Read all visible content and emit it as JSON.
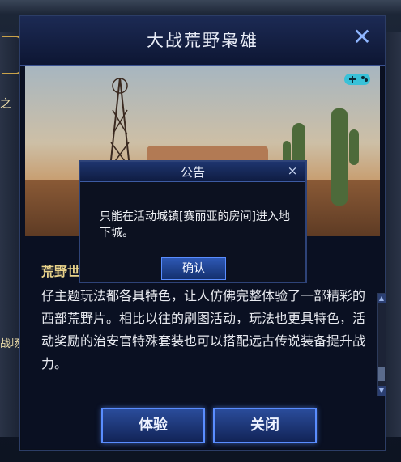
{
  "modal": {
    "title": "大战荒野枭雄",
    "close_glyph": "✕",
    "headline": "荒野世界热血着……德勇士化身西部牛仔",
    "body": "仔主题玩法都各具特色，让人仿佛完整体验了一部精彩的西部荒野片。相比以往的刷图活动，玩法也更具特色，活动奖励的治安官特殊套装也可以搭配远古传说装备提升战力。",
    "buttons": {
      "experience_label": "体验",
      "close_label": "关闭"
    }
  },
  "notice": {
    "title": "公告",
    "close_glyph": "×",
    "message": "只能在活动城镇[赛丽亚的房间]进入地下城。",
    "ok_label": "确认"
  },
  "background": {
    "left_text_1": "之",
    "left_text_2": "战场"
  },
  "colors": {
    "accent": "#5a8dff",
    "headline": "#e9d38b",
    "panel": "#0a1022"
  },
  "icons": {
    "close": "close-icon",
    "gamepad": "gamepad-icon",
    "scroll_up": "scroll-up-icon",
    "scroll_down": "scroll-down-icon"
  }
}
